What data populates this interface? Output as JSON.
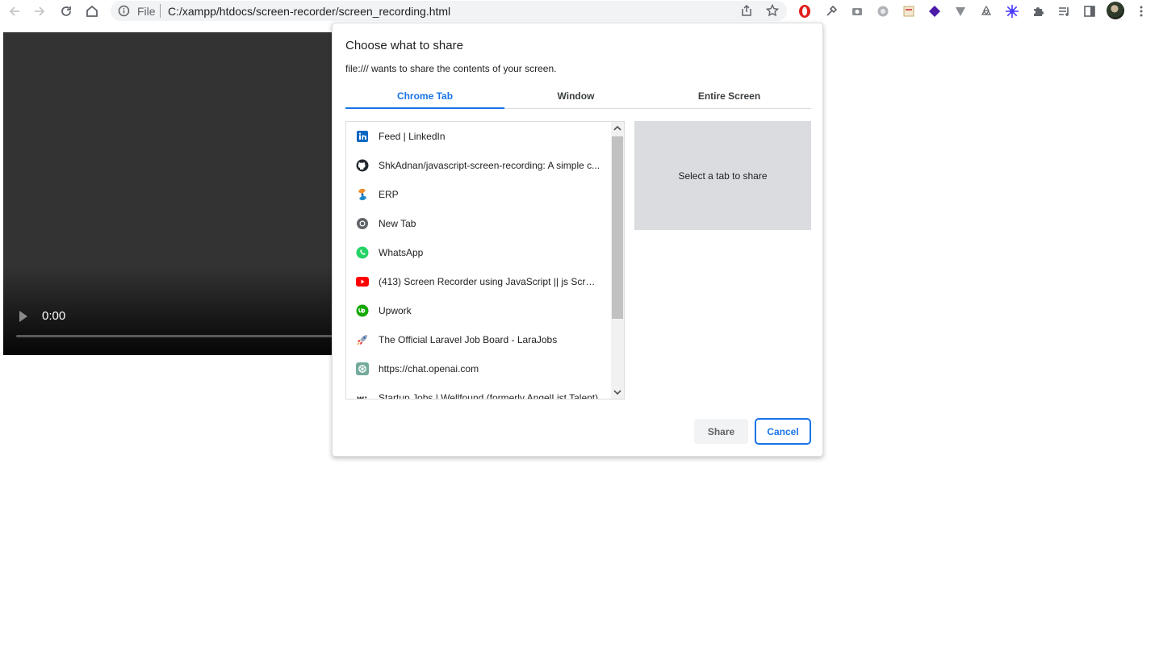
{
  "browser": {
    "address": {
      "scheme_label": "File",
      "url": "C:/xampp/htdocs/screen-recorder/screen_recording.html"
    },
    "extension_icons": [
      "opera-adblock-icon",
      "eyedropper-icon",
      "camera-icon",
      "ext-circle-icon",
      "ext-square-icon",
      "ext-diamond-icon",
      "ext-v-icon",
      "recycle-icon",
      "ext-snowflake-icon",
      "puzzle-icon",
      "media-control-icon",
      "side-panel-icon"
    ]
  },
  "video": {
    "time": "0:00"
  },
  "dialog": {
    "title": "Choose what to share",
    "subtitle": "file:/// wants to share the contents of your screen.",
    "tabs": [
      {
        "label": "Chrome Tab",
        "active": true
      },
      {
        "label": "Window",
        "active": false
      },
      {
        "label": "Entire Screen",
        "active": false
      }
    ],
    "items": [
      {
        "label": "Feed | LinkedIn",
        "icon": "linkedin-icon"
      },
      {
        "label": "ShkAdnan/javascript-screen-recording: A simple c...",
        "icon": "github-icon"
      },
      {
        "label": "ERP",
        "icon": "erp-icon"
      },
      {
        "label": "New Tab",
        "icon": "chrome-icon"
      },
      {
        "label": "WhatsApp",
        "icon": "whatsapp-icon"
      },
      {
        "label": "(413) Screen Recorder using JavaScript || js Screen...",
        "icon": "youtube-icon"
      },
      {
        "label": "Upwork",
        "icon": "upwork-icon"
      },
      {
        "label": "The Official Laravel Job Board - LaraJobs",
        "icon": "rocket-icon"
      },
      {
        "label": "https://chat.openai.com",
        "icon": "openai-icon"
      },
      {
        "label": "Startup Jobs | Wellfound (formerly AngelList Talent)",
        "icon": "wellfound-icon"
      }
    ],
    "preview_text": "Select a tab to share",
    "share_label": "Share",
    "cancel_label": "Cancel"
  },
  "colors": {
    "accent": "#1a73e8",
    "linkedin": "#0a66c2",
    "youtube": "#ff0000",
    "whatsapp": "#25d366",
    "upwork": "#14a800"
  }
}
